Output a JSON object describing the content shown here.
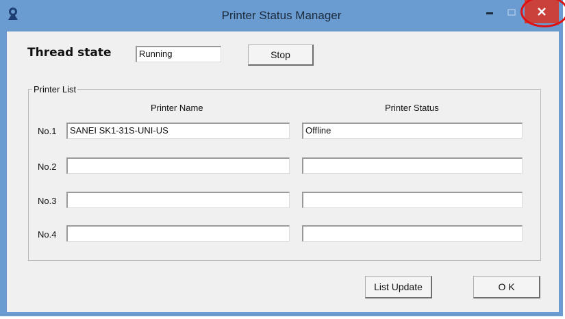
{
  "window": {
    "title": "Printer Status Manager",
    "colors": {
      "frame": "#6a9bd1",
      "close_button": "#c9413a",
      "annotation_ring": "#e01010"
    }
  },
  "thread": {
    "label": "Thread state",
    "value": "Running",
    "stop_label": "Stop"
  },
  "printer_list": {
    "title": "Printer List",
    "col_name": "Printer Name",
    "col_status": "Printer Status",
    "rows": [
      {
        "label": "No.1",
        "name": "SANEI SK1-31S-UNI-US",
        "status": "Offline"
      },
      {
        "label": "No.2",
        "name": "",
        "status": ""
      },
      {
        "label": "No.3",
        "name": "",
        "status": ""
      },
      {
        "label": "No.4",
        "name": "",
        "status": ""
      }
    ]
  },
  "buttons": {
    "list_update": "List Update",
    "ok": "O K"
  },
  "controls": {
    "minimize": "–",
    "maximize": "□",
    "close": "✕"
  }
}
